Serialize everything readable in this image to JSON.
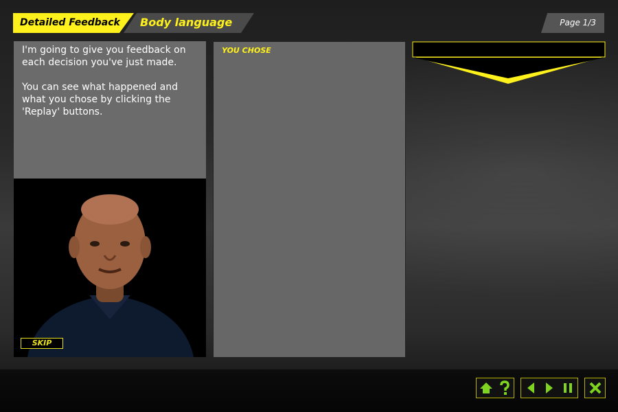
{
  "header": {
    "section_tab": "Detailed Feedback",
    "topic_tab": "Body language",
    "page_indicator": "Page 1/3"
  },
  "presenter": {
    "speech_text": "I'm going to give you feedback on each decision you've just made.\n\nYou can see what happened and what you chose by clicking the 'Replay' buttons.",
    "skip_label": "SKIP"
  },
  "choice_panel": {
    "label": "YOU CHOSE"
  },
  "toolbar": {
    "icons": [
      "home-icon",
      "help-icon",
      "back-icon",
      "forward-icon",
      "pause-icon",
      "close-icon"
    ]
  },
  "colors": {
    "accent": "#fff21c",
    "nav_icon": "#7fd321",
    "panel_grey": "#676767"
  }
}
